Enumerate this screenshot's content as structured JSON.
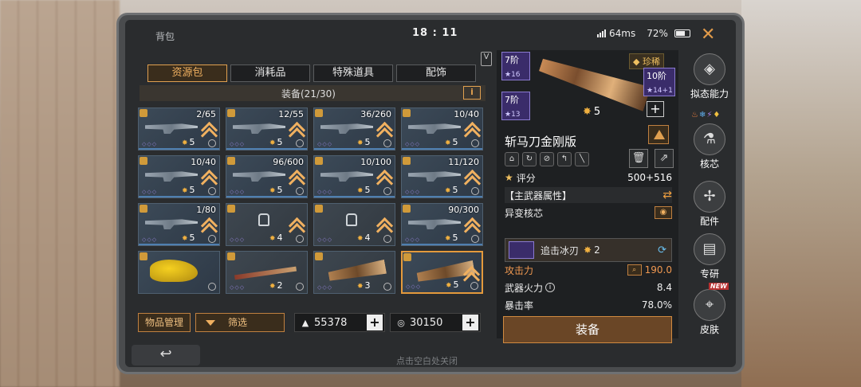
{
  "topbar": {
    "title": "背包",
    "time": "18 : 11",
    "ping": "64ms",
    "battery": "72%"
  },
  "tabs": [
    {
      "label": "资源包",
      "active": true
    },
    {
      "label": "消耗品",
      "active": false
    },
    {
      "label": "特殊道具",
      "active": false
    },
    {
      "label": "配饰",
      "active": false
    }
  ],
  "equipment_header": "装备(21/30)",
  "items": [
    {
      "count": "2/65",
      "level": "5",
      "kind": "gun"
    },
    {
      "count": "12/55",
      "level": "5",
      "kind": "gun"
    },
    {
      "count": "36/260",
      "level": "5",
      "kind": "gun"
    },
    {
      "count": "10/40",
      "level": "5",
      "kind": "gun"
    },
    {
      "count": "10/40",
      "level": "5",
      "kind": "gun"
    },
    {
      "count": "96/600",
      "level": "5",
      "kind": "gun"
    },
    {
      "count": "10/100",
      "level": "5",
      "kind": "gun"
    },
    {
      "count": "11/120",
      "level": "5",
      "kind": "gun"
    },
    {
      "count": "1/80",
      "level": "5",
      "kind": "gun"
    },
    {
      "count": "",
      "level": "4",
      "kind": "locked"
    },
    {
      "count": "",
      "level": "4",
      "kind": "locked"
    },
    {
      "count": "90/300",
      "level": "5",
      "kind": "gun"
    },
    {
      "count": "",
      "level": "",
      "kind": "yellow"
    },
    {
      "count": "",
      "level": "2",
      "kind": "stick"
    },
    {
      "count": "",
      "level": "3",
      "kind": "cleaver"
    },
    {
      "count": "",
      "level": "5",
      "kind": "machete",
      "selected": true
    }
  ],
  "bottom": {
    "manage_label": "物品管理",
    "filter_label": "筛选",
    "currency1": "55378",
    "currency2": "30150",
    "hint": "点击空白处关闭"
  },
  "detail": {
    "tier_top": "7阶",
    "tier_top_sub": "16",
    "tier_bottom": "7阶",
    "tier_bottom_sub": "13",
    "tier_right": "10阶",
    "tier_right_sub": "14+1",
    "rarity": "珍稀",
    "star_level": "5",
    "name": "斩马刀金刚版",
    "score_label": "评分",
    "score_value": "500+516",
    "main_attr_label": "【主武器属性】",
    "core_label": "异变核芯",
    "core_name": "追击冰刃",
    "core_level": "2",
    "stats": [
      {
        "label": "攻击力",
        "value": "190.0",
        "orange": true,
        "search": true
      },
      {
        "label": "武器火力",
        "value": "8.4",
        "info": true
      },
      {
        "label": "暴击率",
        "value": "78.0%"
      }
    ],
    "equip_button": "装备"
  },
  "side_menu": [
    {
      "label": "拟态能力",
      "icon": "mimic-icon"
    },
    {
      "label": "核芯",
      "icon": "core-icon"
    },
    {
      "label": "配件",
      "icon": "parts-icon"
    },
    {
      "label": "专研",
      "icon": "research-icon"
    },
    {
      "label": "皮肤",
      "icon": "skin-icon",
      "badge": "NEW"
    }
  ],
  "colors": {
    "accent": "#e0a050",
    "purple_tier": "#3a2c6a"
  }
}
